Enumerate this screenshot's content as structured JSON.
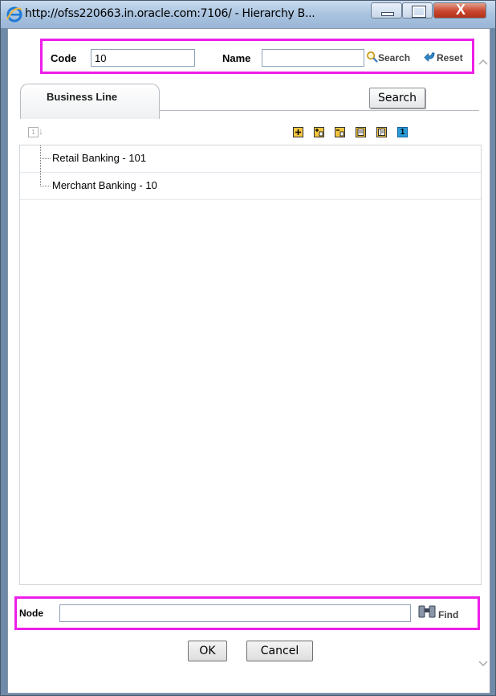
{
  "window": {
    "title": "http://ofss220663.in.oracle.com:7106/ - Hierarchy B...",
    "close_glyph": "X"
  },
  "search_bar": {
    "code_label": "Code",
    "code_value": "10",
    "name_label": "Name",
    "name_value": "",
    "search_label": "Search",
    "reset_label": "Reset"
  },
  "tabs": [
    {
      "label": "Business Line",
      "selected": true
    }
  ],
  "search_button": "Search",
  "toolbar": {
    "icons": [
      "sort-order-icon",
      "expand-all-icon",
      "expand-branch-icon",
      "collapse-branch-icon",
      "show-code-icon",
      "show-name-icon",
      "show-level-icon"
    ],
    "level_glyph": "1"
  },
  "tree": {
    "nodes": [
      {
        "label": "Retail Banking - 101"
      },
      {
        "label": "Merchant Banking - 10"
      }
    ]
  },
  "footer": {
    "node_label": "Node",
    "node_value": "",
    "find_label": "Find",
    "ok_label": "OK",
    "cancel_label": "Cancel"
  },
  "colors": {
    "highlight": "#ee1ee8",
    "toolbar_icon_fill": "#f3c642",
    "level_icon_fill": "#2a9ad8"
  }
}
